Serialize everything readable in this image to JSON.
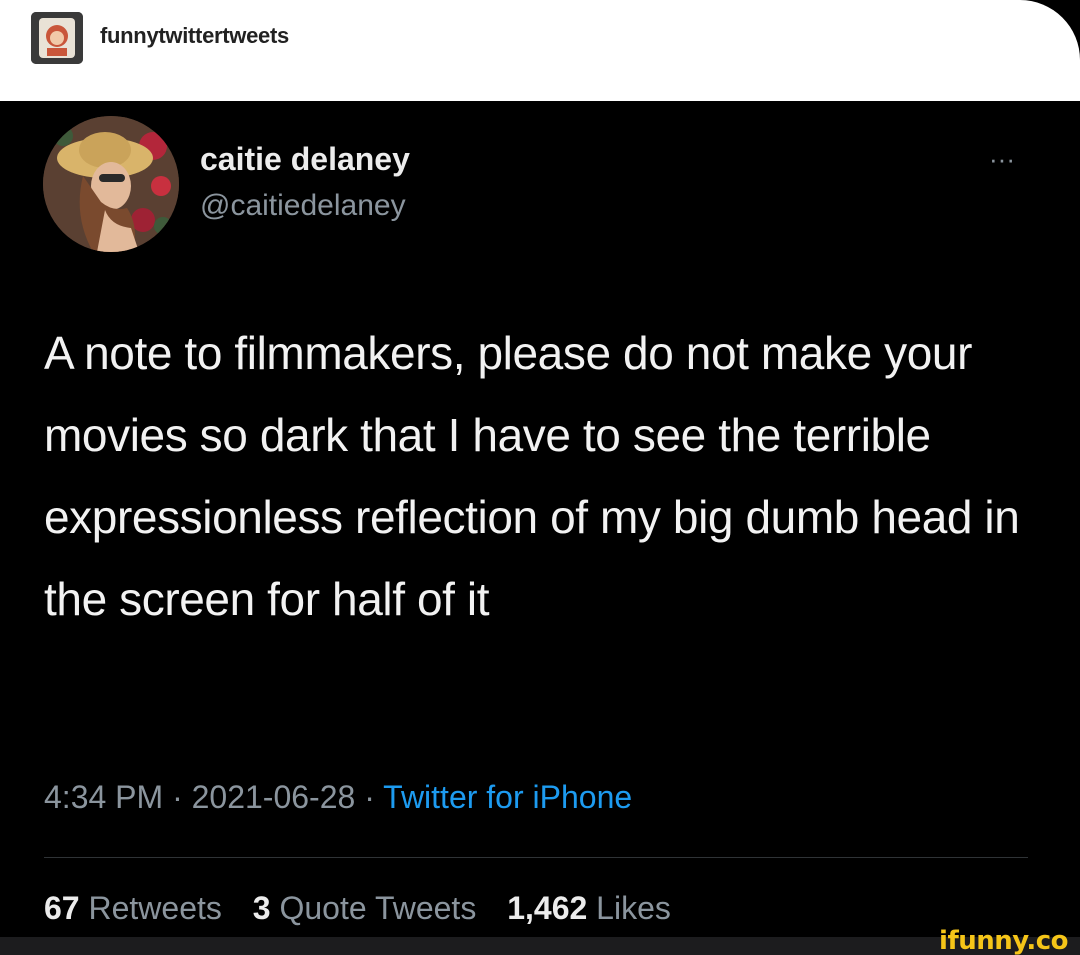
{
  "post_header": {
    "blog_name": "funnytwittertweets"
  },
  "tweet": {
    "display_name": "caitie delaney",
    "handle": "@caitiedelaney",
    "more_icon": "···",
    "text": "A note to filmmakers, please do not make your movies so dark that I have to see the terrible expressionless reflection of my big dumb head in the screen for half of it",
    "time": "4:34 PM",
    "sep1": " · ",
    "date": "2021-06-28",
    "sep2": " · ",
    "source": "Twitter for iPhone"
  },
  "stats": {
    "retweets_count": "67",
    "retweets_label": "Retweets",
    "quotes_count": "3",
    "quotes_label": "Quote Tweets",
    "likes_count": "1,462",
    "likes_label": "Likes"
  },
  "watermark": "ifunny.co",
  "colors": {
    "background": "#000000",
    "link": "#1d9bf0",
    "secondary_text": "#8b959e",
    "watermark": "#f5c518"
  }
}
